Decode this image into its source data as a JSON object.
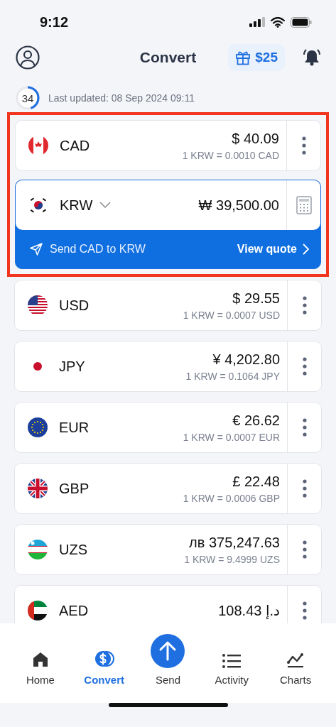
{
  "status_bar": {
    "time": "9:12"
  },
  "header": {
    "title": "Convert",
    "reward": "$25"
  },
  "refresh": {
    "seconds": "34",
    "text": "Last updated: 08 Sep 2024 09:11"
  },
  "highlighted": [
    {
      "code": "CAD",
      "amount": "$ 40.09",
      "rate": "1 KRW = 0.0010 CAD",
      "selected": false
    },
    {
      "code": "KRW",
      "amount": "₩ 39,500.00",
      "selected": true,
      "send_label": "Send CAD to KRW",
      "quote_label": "View quote"
    }
  ],
  "currencies": [
    {
      "code": "USD",
      "amount": "$ 29.55",
      "rate": "1 KRW = 0.0007 USD",
      "selected": false
    },
    {
      "code": "JPY",
      "amount": "¥ 4,202.80",
      "rate": "1 KRW = 0.1064 JPY",
      "selected": false
    },
    {
      "code": "EUR",
      "amount": "€ 26.62",
      "rate": "1 KRW = 0.0007 EUR",
      "selected": false
    },
    {
      "code": "GBP",
      "amount": "£ 22.48",
      "rate": "1 KRW = 0.0006 GBP",
      "selected": false
    },
    {
      "code": "UZS",
      "amount": "лв 375,247.63",
      "rate": "1 KRW = 9.4999 UZS",
      "selected": false
    },
    {
      "code": "AED",
      "amount": "د.إ 108.43",
      "selected": false
    }
  ],
  "tabs": [
    {
      "label": "Home",
      "selected": false
    },
    {
      "label": "Convert",
      "selected": true
    },
    {
      "label": "Send",
      "selected": false
    },
    {
      "label": "Activity",
      "selected": false
    },
    {
      "label": "Charts",
      "selected": false
    }
  ]
}
